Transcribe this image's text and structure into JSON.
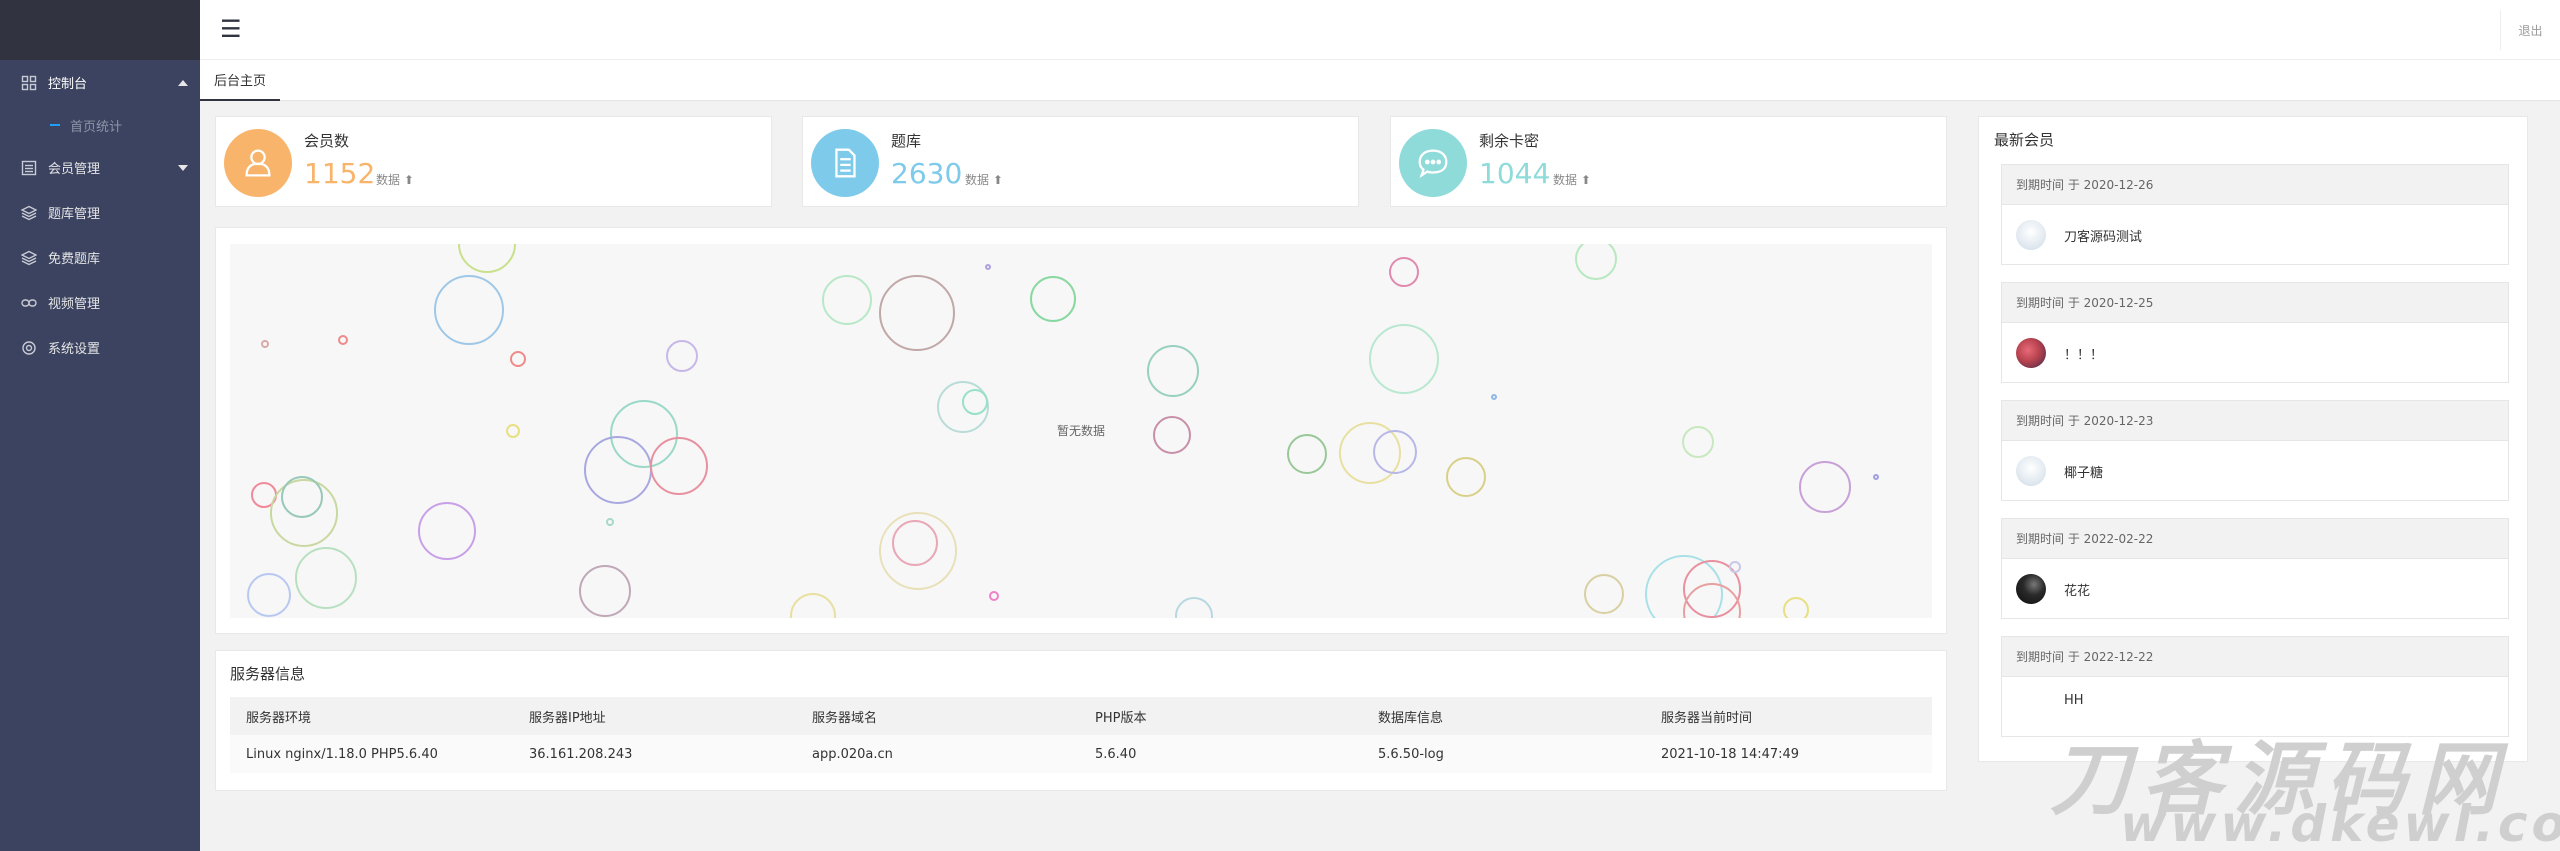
{
  "sidebar": {
    "items": [
      {
        "label": "控制台",
        "icon": "dashboard-icon",
        "expanded": true
      },
      {
        "label": "首页统计",
        "icon": "dash-icon"
      },
      {
        "label": "会员管理",
        "icon": "list-icon",
        "expanded": false
      },
      {
        "label": "题库管理",
        "icon": "layers-icon"
      },
      {
        "label": "免费题库",
        "icon": "layers-icon"
      },
      {
        "label": "视频管理",
        "icon": "link-icon"
      },
      {
        "label": "系统设置",
        "icon": "gear-icon"
      }
    ]
  },
  "topbar": {
    "menu_icon": "☰",
    "logout_label": "退出"
  },
  "tabs": [
    {
      "label": "后台主页",
      "active": true
    }
  ],
  "stats": [
    {
      "title": "会员数",
      "value": "1152",
      "sub": "数据 ⬆",
      "color": "#f7b46a",
      "icon": "user-icon"
    },
    {
      "title": "题库",
      "value": "2630",
      "sub": "数据 ⬆",
      "color": "#7dcaea",
      "icon": "document-icon"
    },
    {
      "title": "剩余卡密",
      "value": "1044",
      "sub": "数据 ⬆",
      "color": "#8fdbd9",
      "icon": "chat-icon"
    }
  ],
  "chart": {
    "no_data": "暂无数据"
  },
  "server": {
    "title": "服务器信息",
    "headers": [
      "服务器环境",
      "服务器IP地址",
      "服务器域名",
      "PHP版本",
      "数据库信息",
      "服务器当前时间"
    ],
    "row": [
      "Linux nginx/1.18.0 PHP5.6.40",
      "36.161.208.243",
      "app.020a.cn",
      "5.6.40",
      "5.6.50-log",
      "2021-10-18 14:47:49"
    ]
  },
  "members": {
    "title": "最新会员",
    "list": [
      {
        "expire": "到期时间 于 2020-12-26",
        "name": "刀客源码测试",
        "avatar_color": "#dde6ee"
      },
      {
        "expire": "到期时间 于 2020-12-25",
        "name": "！！！",
        "avatar_color": "#b8434f"
      },
      {
        "expire": "到期时间 于 2020-12-23",
        "name": "椰子糖",
        "avatar_color": "#dde6ee"
      },
      {
        "expire": "到期时间 于 2022-02-22",
        "name": "花花",
        "avatar_color": "#1d1d1d"
      },
      {
        "expire": "到期时间 于 2022-12-22",
        "name": "HH",
        "avatar_color": ""
      }
    ]
  },
  "watermark": {
    "line1": "刀客源码网",
    "line2": "www.dkewl.com"
  },
  "colors": {
    "sidebar_bg": "#3b4360",
    "logo_bg": "#313440",
    "accent": "#1e9fff"
  }
}
